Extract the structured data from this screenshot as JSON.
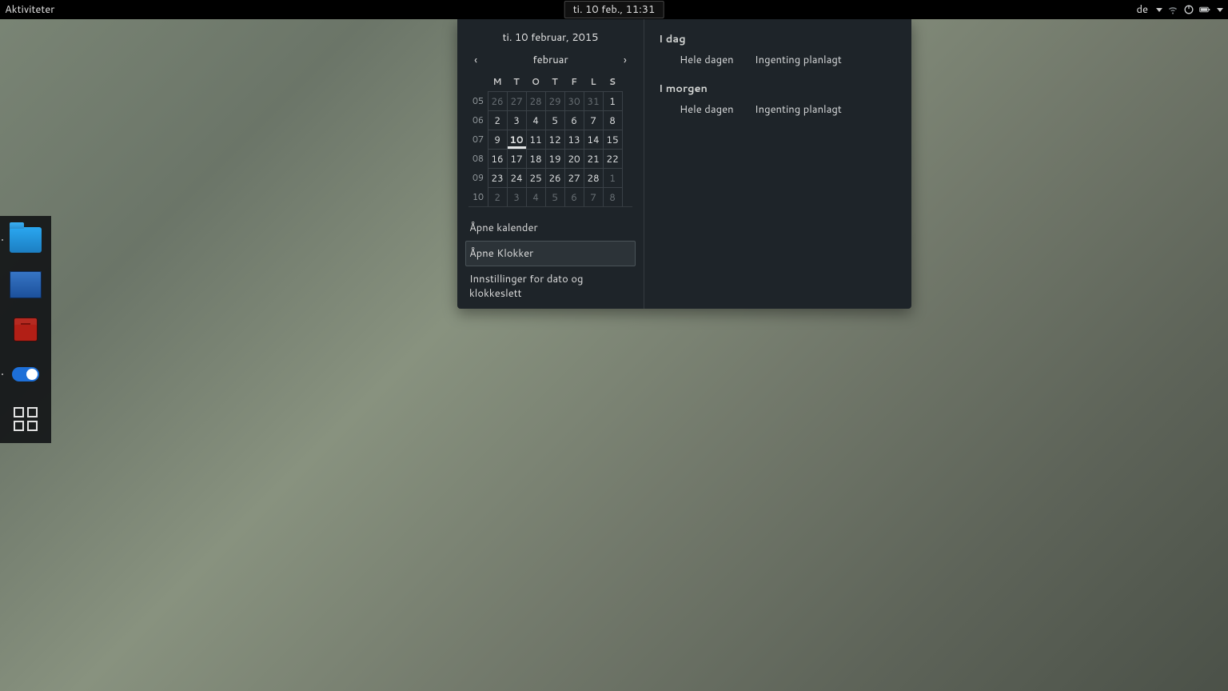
{
  "topbar": {
    "activities": "Aktiviteter",
    "clock": "ti. 10 feb., 11:31",
    "keyboard_layout": "de"
  },
  "dock": {
    "items": [
      "files",
      "maps",
      "dictionary",
      "settings-toggle",
      "show-apps"
    ]
  },
  "calendar": {
    "date_header": "ti. 10 februar, 2015",
    "month_label": "februar",
    "weekday_headers": [
      "M",
      "T",
      "O",
      "T",
      "F",
      "L",
      "S"
    ],
    "week_numbers": [
      "05",
      "06",
      "07",
      "08",
      "09",
      "10"
    ],
    "rows": [
      [
        {
          "d": "26",
          "other": true
        },
        {
          "d": "27",
          "other": true
        },
        {
          "d": "28",
          "other": true
        },
        {
          "d": "29",
          "other": true
        },
        {
          "d": "30",
          "other": true
        },
        {
          "d": "31",
          "other": true
        },
        {
          "d": "1"
        }
      ],
      [
        {
          "d": "2"
        },
        {
          "d": "3"
        },
        {
          "d": "4"
        },
        {
          "d": "5"
        },
        {
          "d": "6"
        },
        {
          "d": "7"
        },
        {
          "d": "8"
        }
      ],
      [
        {
          "d": "9"
        },
        {
          "d": "10",
          "today": true
        },
        {
          "d": "11"
        },
        {
          "d": "12"
        },
        {
          "d": "13"
        },
        {
          "d": "14"
        },
        {
          "d": "15"
        }
      ],
      [
        {
          "d": "16"
        },
        {
          "d": "17"
        },
        {
          "d": "18"
        },
        {
          "d": "19"
        },
        {
          "d": "20"
        },
        {
          "d": "21"
        },
        {
          "d": "22"
        }
      ],
      [
        {
          "d": "23"
        },
        {
          "d": "24"
        },
        {
          "d": "25"
        },
        {
          "d": "26"
        },
        {
          "d": "27"
        },
        {
          "d": "28"
        },
        {
          "d": "1",
          "other": true
        }
      ],
      [
        {
          "d": "2",
          "other": true
        },
        {
          "d": "3",
          "other": true
        },
        {
          "d": "4",
          "other": true
        },
        {
          "d": "5",
          "other": true
        },
        {
          "d": "6",
          "other": true
        },
        {
          "d": "7",
          "other": true
        },
        {
          "d": "8",
          "other": true
        }
      ]
    ],
    "links": {
      "open_calendar": "Åpne kalender",
      "open_clocks": "Åpne Klokker",
      "date_time_settings": "Innstillinger for dato og klokkeslett"
    }
  },
  "agenda": {
    "today": {
      "title": "I dag",
      "all_day": "Hele dagen",
      "nothing": "Ingenting planlagt"
    },
    "tomorrow": {
      "title": "I morgen",
      "all_day": "Hele dagen",
      "nothing": "Ingenting planlagt"
    }
  }
}
